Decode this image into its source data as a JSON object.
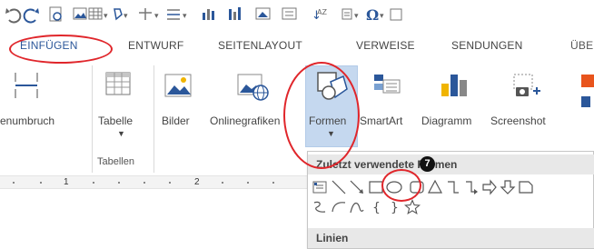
{
  "quick_access_toolbar": {
    "icons": [
      "undo-icon",
      "redo-icon",
      "page-layout-icon",
      "picture-icon",
      "table-icon",
      "shapes-icon",
      "insert-icon",
      "align-icon",
      "chart-icon",
      "wordart-icon",
      "picture-style-icon",
      "textbox-icon",
      "sort-icon",
      "numbering-icon",
      "symbol-icon",
      "more-icon"
    ]
  },
  "tabs": [
    {
      "label": "EINFÜGEN",
      "active": true
    },
    {
      "label": "ENTWURF"
    },
    {
      "label": "SEITENLAYOUT"
    },
    {
      "label": "VERWEISE"
    },
    {
      "label": "SENDUNGEN"
    },
    {
      "label": "ÜBE"
    }
  ],
  "ribbon": {
    "buttons": {
      "seitenumbruch": "enumbruch",
      "tabelle": "Tabelle",
      "bilder": "Bilder",
      "onlinegrafiken": "Onlinegrafiken",
      "formen": "Formen",
      "smartart": "SmartArt",
      "diagramm": "Diagramm",
      "screenshot": "Screenshot"
    },
    "group_tabellen": "Tabellen"
  },
  "ruler": {
    "numbers": [
      "1",
      "2"
    ]
  },
  "shapes_dropdown": {
    "header_recent": "Zuletzt verwendete Formen",
    "header_lines": "Linien",
    "recent_shapes_row1": [
      "text-box-shape",
      "line-shape",
      "arrow-line-shape",
      "rectangle-shape",
      "oval-shape",
      "rounded-rectangle-shape",
      "triangle-shape",
      "elbow-connector-shape",
      "elbow-arrow-connector-shape",
      "right-arrow-shape",
      "down-arrow-shape",
      "snip-rectangle-shape"
    ],
    "recent_shapes_row2": [
      "freeform-scribble-shape",
      "arc-shape",
      "curve-shape",
      "left-brace-shape",
      "right-brace-shape",
      "star-shape"
    ]
  },
  "annotation": {
    "step_number": "7",
    "highlight_color": "#e0262b",
    "accent_color": "#2b579a"
  }
}
